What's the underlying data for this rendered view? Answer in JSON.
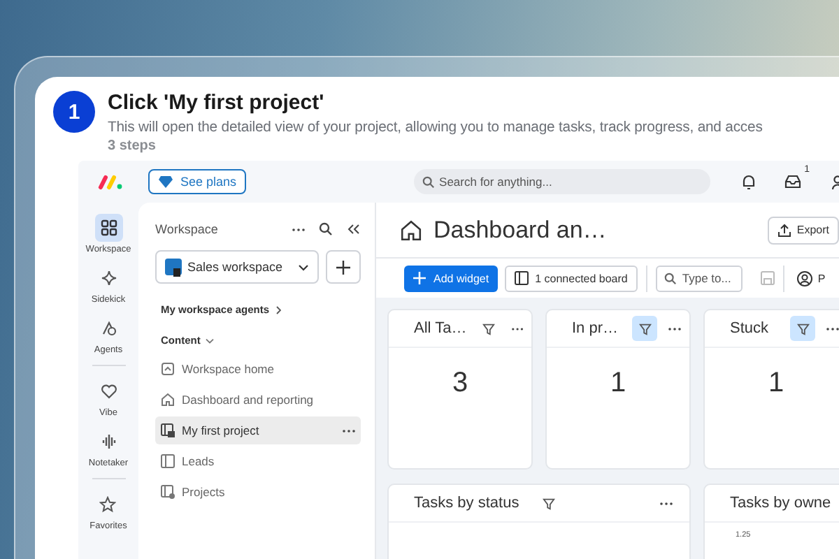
{
  "step": {
    "number": "1",
    "title": "Click 'My first project'",
    "description": "This will open the detailed view of your project, allowing you to manage tasks, track progress, and acces",
    "meta": "3 steps"
  },
  "topbar": {
    "plans_button": "See plans",
    "search_placeholder": "Search for anything...",
    "inbox_badge": "1"
  },
  "rail": [
    {
      "label": "Workspace",
      "kind": "grid",
      "selected": true
    },
    {
      "label": "Sidekick",
      "kind": "sparkle",
      "selected": false
    },
    {
      "label": "Agents",
      "kind": "agent",
      "selected": false
    },
    {
      "kind": "divider"
    },
    {
      "label": "Vibe",
      "kind": "heart",
      "selected": false
    },
    {
      "label": "Notetaker",
      "kind": "wave",
      "selected": false
    },
    {
      "kind": "divider"
    },
    {
      "label": "Favorites",
      "kind": "star",
      "selected": false
    }
  ],
  "workspace_panel": {
    "title": "Workspace",
    "workspace_select": "Sales workspace",
    "agents_link": "My workspace agents",
    "content_heading": "Content",
    "items": [
      {
        "label": "Workspace home",
        "kind": "home",
        "selected": false
      },
      {
        "label": "Dashboard and reporting",
        "kind": "dashboard",
        "selected": false
      },
      {
        "label": "My first project",
        "kind": "project",
        "selected": true
      },
      {
        "label": "Leads",
        "kind": "board",
        "selected": false
      },
      {
        "label": "Projects",
        "kind": "projects",
        "selected": false
      }
    ]
  },
  "dashboard": {
    "title": "Dashboard an…",
    "export_button": "Export",
    "add_widget_button": "Add widget",
    "connected_board_button": "1 connected board",
    "filter_placeholder": "Type to...",
    "person_button": "P",
    "widgets": [
      {
        "kind": "number",
        "title": "All Ta…",
        "value": "3",
        "filter_active": false
      },
      {
        "kind": "number",
        "title": "In pr…",
        "value": "1",
        "filter_active": true
      },
      {
        "kind": "number",
        "title": "Stuck",
        "value": "1",
        "filter_active": true
      },
      {
        "kind": "chart",
        "title": "Tasks by status",
        "filter_active": false
      },
      {
        "kind": "chart",
        "title": "Tasks by owne",
        "axis_label": "1.25"
      }
    ]
  }
}
